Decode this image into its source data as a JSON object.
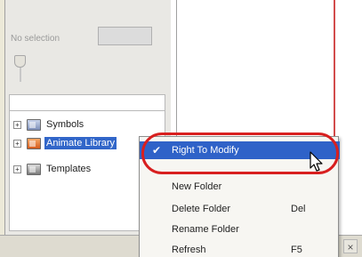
{
  "selection_panel": {
    "label": "No selection",
    "value": ""
  },
  "tree": {
    "items": [
      {
        "label": "Symbols",
        "icon": "symbols-folder-icon",
        "expander": "+"
      },
      {
        "label": "Animate Library",
        "icon": "animate-library-folder-icon",
        "expander": "+",
        "selected": true
      },
      {
        "label": "Templates",
        "icon": "templates-folder-icon",
        "expander": "+"
      }
    ]
  },
  "context_menu": {
    "items": [
      {
        "label": "Right To Modify",
        "shortcut": "",
        "checked": true,
        "check_glyph": "✔",
        "highlighted": true
      },
      {
        "label": "New Folder",
        "shortcut": ""
      },
      {
        "label": "Delete Folder",
        "shortcut": "Del"
      },
      {
        "label": "Rename Folder",
        "shortcut": ""
      },
      {
        "label": "Refresh",
        "shortcut": "F5"
      }
    ]
  },
  "bottom_bar": {
    "close_glyph": "×"
  },
  "colors": {
    "highlight": "#2f62c8",
    "annotation": "#d81f1f",
    "selection": "#3166c9"
  }
}
